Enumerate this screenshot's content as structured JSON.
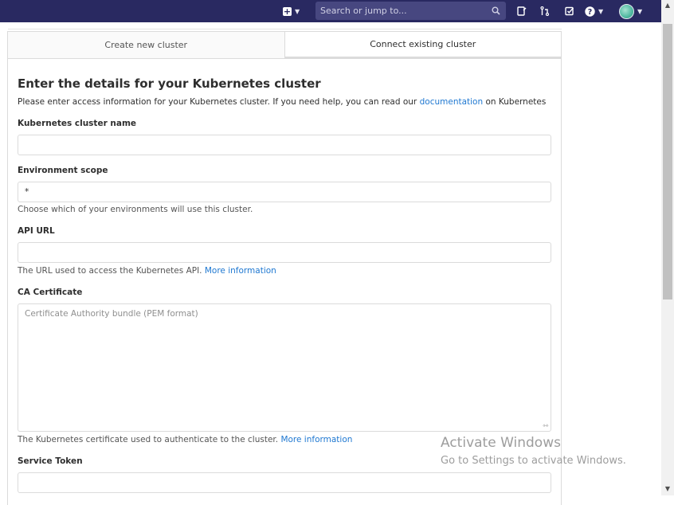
{
  "navbar": {
    "search_placeholder": "Search or jump to...",
    "icons": [
      "plus-icon",
      "chevron-down-icon",
      "search-icon",
      "todo-icon",
      "merge-request-icon",
      "issues-check-icon",
      "help-icon",
      "avatar"
    ]
  },
  "tabs": [
    {
      "label": "Create new cluster",
      "active": false
    },
    {
      "label": "Connect existing cluster",
      "active": true
    }
  ],
  "form": {
    "heading": "Enter the details for your Kubernetes cluster",
    "intro_text": "Please enter access information for your Kubernetes cluster. If you need help, you can read our",
    "intro_link": "documentation",
    "intro_suffix": "on Kubernetes",
    "cluster_name": {
      "label": "Kubernetes cluster name",
      "value": ""
    },
    "environment_scope": {
      "label": "Environment scope",
      "value": "*",
      "help": "Choose which of your environments will use this cluster."
    },
    "api_url": {
      "label": "API URL",
      "value": "",
      "help": "The URL used to access the Kubernetes API.",
      "help_link": "More information"
    },
    "ca_certificate": {
      "label": "CA Certificate",
      "placeholder": "Certificate Authority bundle (PEM format)",
      "help": "The Kubernetes certificate used to authenticate to the cluster.",
      "help_link": "More information"
    },
    "service_token": {
      "label": "Service Token",
      "value": ""
    }
  },
  "watermark": {
    "title": "Activate Windows",
    "subtitle": "Go to Settings to activate Windows."
  },
  "colors": {
    "navbar": "#292961",
    "link": "#1f78d1"
  }
}
